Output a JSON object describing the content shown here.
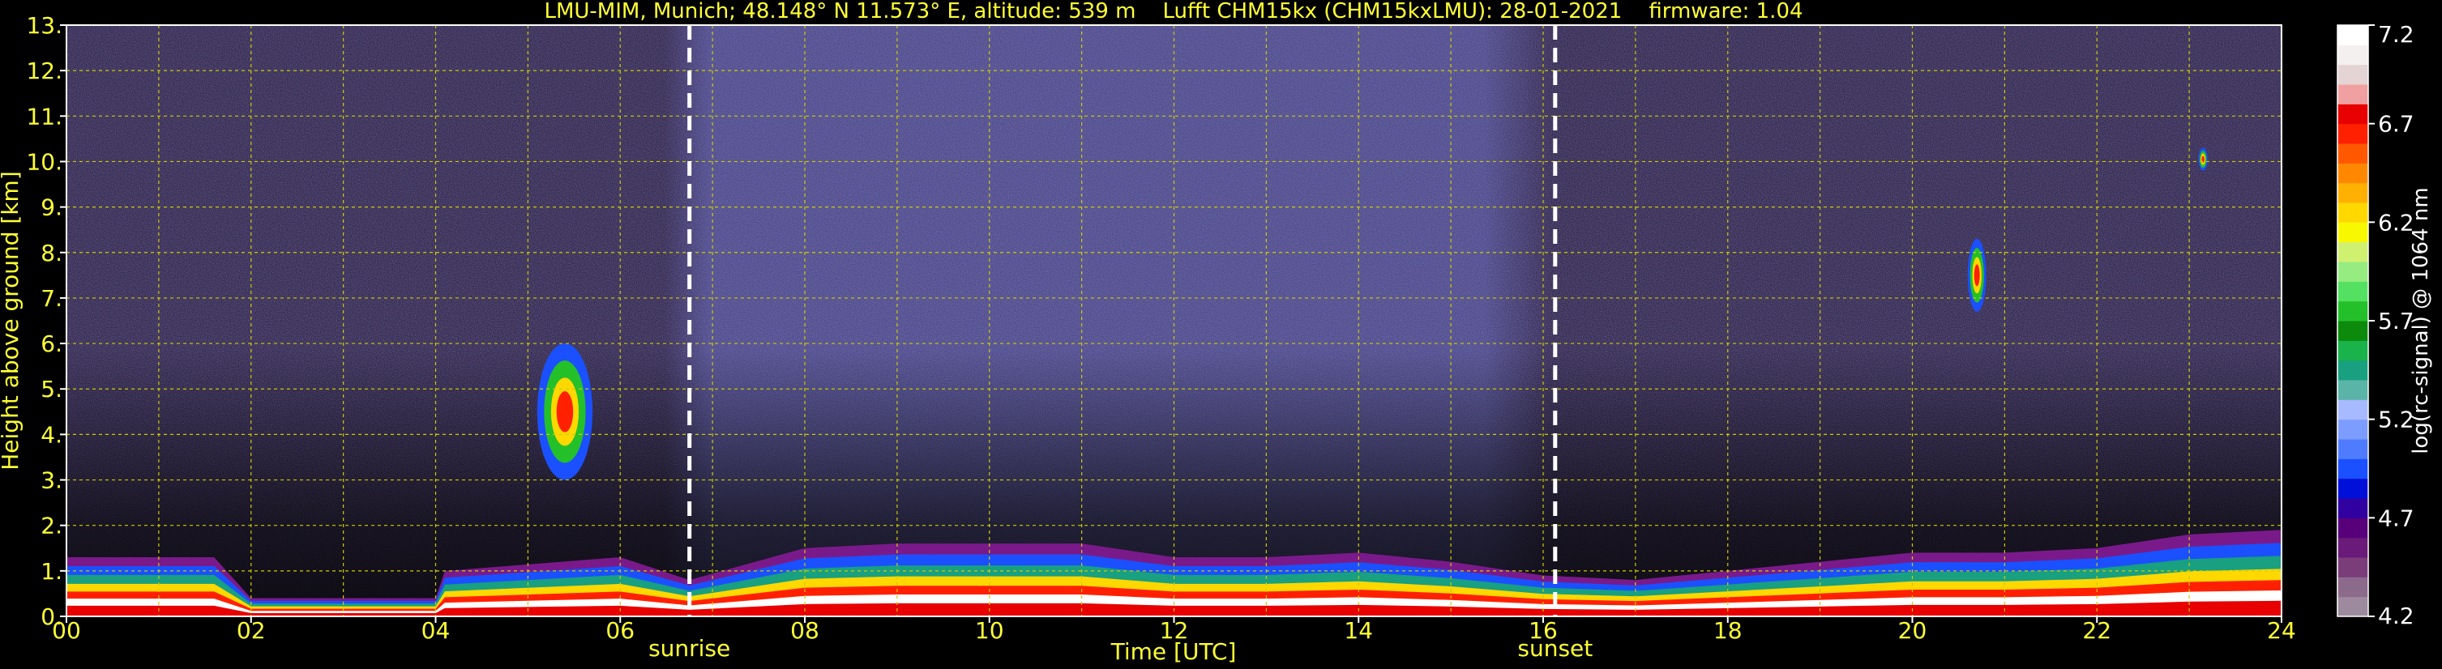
{
  "chart_data": {
    "type": "heatmap",
    "title": "LMU-MIM, Munich; 48.148° N 11.573° E, altitude: 539 m    Lufft CHM15kx (CHM15kxLMU): 28-01-2021    firmware: 1.04",
    "xlabel": "Time [UTC]",
    "ylabel": "Height above ground [km]",
    "xlim": [
      0,
      24
    ],
    "ylim": [
      0,
      13
    ],
    "x_ticks": [
      "00",
      "02",
      "04",
      "06",
      "08",
      "10",
      "12",
      "14",
      "16",
      "18",
      "20",
      "22",
      "24"
    ],
    "y_ticks": [
      "0.",
      "1.",
      "2.",
      "3.",
      "4.",
      "5.",
      "6.",
      "7.",
      "8.",
      "9.",
      "10.",
      "11.",
      "12.",
      "13."
    ],
    "grid": true,
    "grid_color": "#cccc00",
    "colorbar": {
      "label": "log(rc-signal) @ 1064 nm",
      "range": [
        4.2,
        7.2
      ],
      "ticks": [
        "4.2",
        "4.7",
        "5.2",
        "5.7",
        "6.2",
        "6.7",
        "7.2"
      ],
      "colors": [
        "#9e8a9e",
        "#8c6a8c",
        "#7a3d7a",
        "#6a1a78",
        "#58007a",
        "#3000a0",
        "#0010d8",
        "#1a50ff",
        "#4f7cff",
        "#7d9cff",
        "#a8baff",
        "#5ab4a8",
        "#18a080",
        "#1ab24a",
        "#0c8a0c",
        "#24c02a",
        "#54e060",
        "#96ec80",
        "#d0f070",
        "#f8f800",
        "#ffd800",
        "#ffb000",
        "#ff8800",
        "#ff5800",
        "#ff2000",
        "#e80000",
        "#f0a0a0",
        "#e4d4d4",
        "#f4f0f0",
        "#ffffff"
      ]
    },
    "markers": [
      {
        "label": "sunrise",
        "x": 6.75
      },
      {
        "label": "sunset",
        "x": 16.13
      }
    ],
    "layers": [
      {
        "desc": "boundary layer top",
        "x": [
          0,
          1.6,
          2.0,
          4.0,
          4.1,
          6.0,
          6.75,
          8,
          9,
          10,
          11,
          12,
          13,
          14,
          15,
          16,
          17,
          18,
          19,
          20,
          21,
          22,
          23,
          24
        ],
        "y": [
          1.3,
          1.3,
          0.4,
          0.4,
          1.0,
          1.3,
          0.8,
          1.5,
          1.6,
          1.6,
          1.6,
          1.3,
          1.3,
          1.4,
          1.2,
          0.9,
          0.8,
          1.0,
          1.2,
          1.4,
          1.4,
          1.5,
          1.8,
          1.9
        ]
      },
      {
        "desc": "cloud",
        "x_range": [
          5.1,
          5.7
        ],
        "y_range": [
          3.0,
          6.0
        ]
      },
      {
        "desc": "cloud",
        "x_range": [
          20.6,
          20.8
        ],
        "y_range": [
          6.7,
          8.3
        ]
      },
      {
        "desc": "cloud",
        "x_range": [
          23.1,
          23.2
        ],
        "y_range": [
          9.8,
          10.3
        ]
      }
    ]
  }
}
